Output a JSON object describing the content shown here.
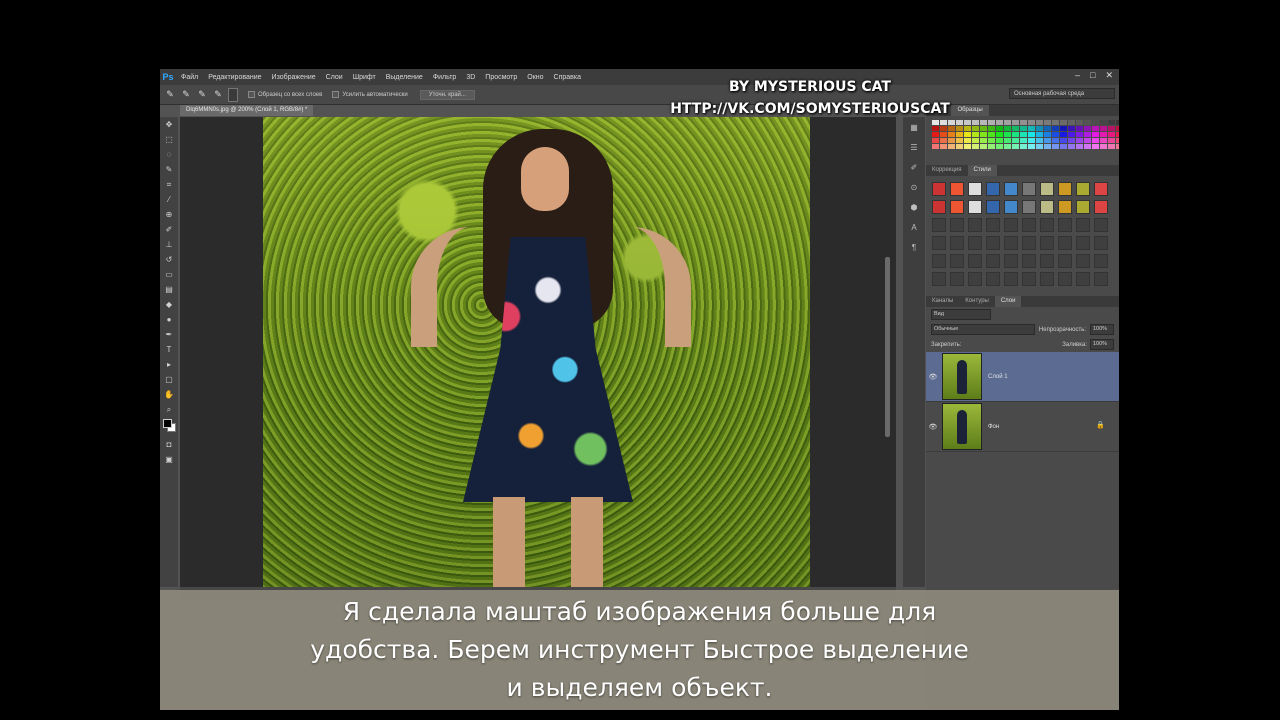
{
  "menu": {
    "logo": "Ps",
    "items": [
      "Файл",
      "Редактирование",
      "Изображение",
      "Слои",
      "Шрифт",
      "Выделение",
      "Фильтр",
      "3D",
      "Просмотр",
      "Окно",
      "Справка"
    ]
  },
  "options_bar": {
    "sample_all_layers": "Образец со всех слоев",
    "auto_enhance": "Усилить автоматически",
    "refine_edge": "Уточн. край...",
    "workspace": "Основная рабочая среда"
  },
  "document_tab": "Dlq6MMN0s.jpg @ 200% (Слой 1, RGB/8#) *",
  "panels": {
    "top_tabs": [
      "Цвет",
      "Образцы"
    ],
    "mid_tabs": [
      "Коррекция",
      "Стили"
    ],
    "layers_tabs": [
      "Каналы",
      "Контуры",
      "Слои"
    ],
    "kind_filter": "Вид",
    "blend_mode": "Обычные",
    "opacity_label": "Непрозрачность:",
    "opacity_value": "100%",
    "lock_label": "Закрепить:",
    "fill_label": "Заливка:",
    "fill_value": "100%",
    "layers": [
      {
        "name": "Слой 1",
        "active": true
      },
      {
        "name": "Фон",
        "active": false
      }
    ]
  },
  "watermark": {
    "line1": "BY MYSTERIOUS CAT",
    "line2": "HTTP://VK.COM/SOMYSTERIOUSCAT"
  },
  "caption": "Я сделала маштаб изображения больше для\nудобства. Берем инструмент Быстрое выделение\nи выделяем объект.",
  "colors": {
    "menu_bg": "#3c3c3c",
    "panel_bg": "#4a4a4a",
    "active_layer": "#5b6b92",
    "caption_bg": "#8e897b"
  }
}
